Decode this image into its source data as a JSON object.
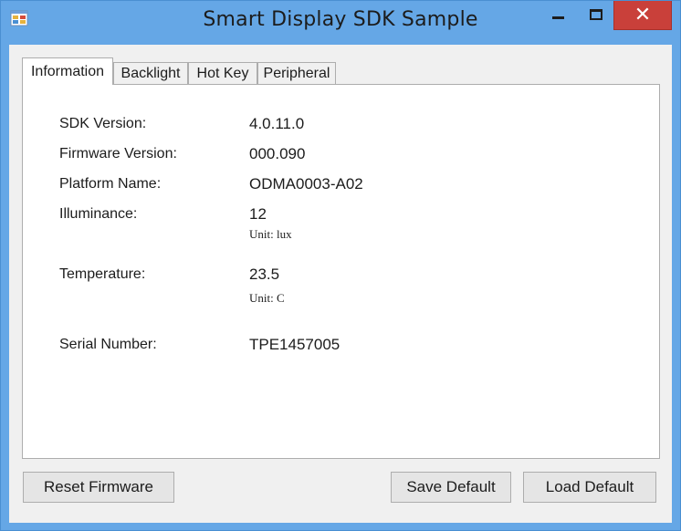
{
  "window": {
    "title": "Smart Display SDK Sample",
    "close_glyph": "✕",
    "icons": {
      "app": "app-window-icon",
      "minimize": "minimize-icon",
      "maximize": "maximize-icon",
      "close": "close-icon"
    },
    "colors": {
      "frame": "#65a7e6",
      "close": "#c9403a",
      "client": "#f0f0f0"
    }
  },
  "tabs": [
    {
      "label": "Information",
      "active": true
    },
    {
      "label": "Backlight",
      "active": false
    },
    {
      "label": "Hot Key",
      "active": false
    },
    {
      "label": "Peripheral",
      "active": false
    }
  ],
  "information": {
    "sdk_version": {
      "label": "SDK Version:",
      "value": "4.0.11.0"
    },
    "firmware_version": {
      "label": "Firmware Version:",
      "value": "000.090"
    },
    "platform_name": {
      "label": "Platform Name:",
      "value": "ODMA0003-A02"
    },
    "illuminance": {
      "label": "Illuminance:",
      "value": "12",
      "unit": "Unit: lux"
    },
    "temperature": {
      "label": "Temperature:",
      "value": "23.5",
      "unit": "Unit: C"
    },
    "serial_number": {
      "label": "Serial Number:",
      "value": "TPE1457005"
    }
  },
  "buttons": {
    "reset_firmware": "Reset Firmware",
    "save_default": "Save Default",
    "load_default": "Load Default"
  }
}
